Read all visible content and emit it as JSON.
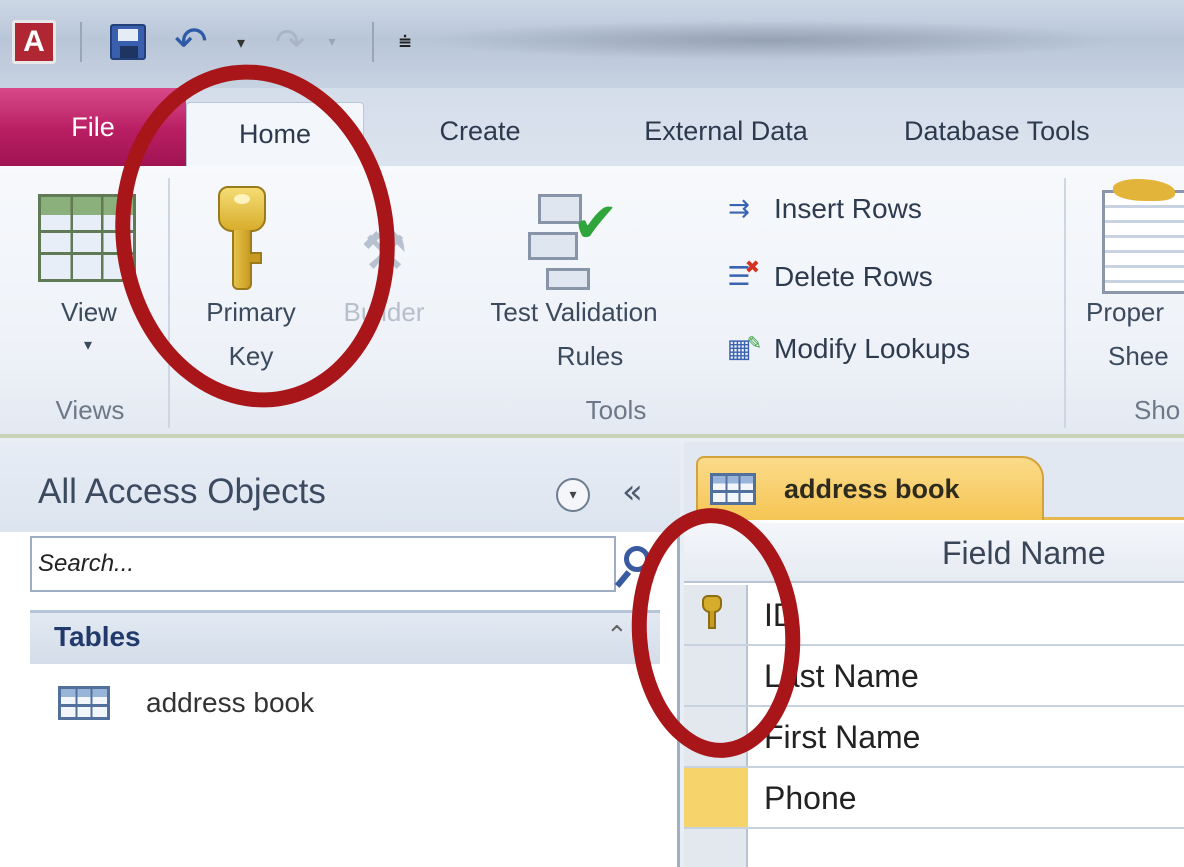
{
  "quick_access_toolbar": {
    "app_icon_letter": "A",
    "icons": [
      "save-icon",
      "undo-icon",
      "redo-icon",
      "customize-icon"
    ]
  },
  "ribbon_tabs": {
    "file": "File",
    "home": "Home",
    "create": "Create",
    "external_data": "External Data",
    "database_tools": "Database Tools"
  },
  "ribbon": {
    "view_button_label": "View",
    "views_group_label": "Views",
    "primary_key_line1": "Primary",
    "primary_key_line2": "Key",
    "builder_label": "Builder",
    "test_validation_line1": "Test Validation",
    "test_validation_line2": "Rules",
    "insert_rows": "Insert Rows",
    "delete_rows": "Delete Rows",
    "modify_lookups": "Modify Lookups",
    "tools_group_label": "Tools",
    "property_sheet_line1": "Proper",
    "property_sheet_line2": "Shee",
    "show_group_label": "Sho"
  },
  "nav_pane": {
    "title": "All Access Objects",
    "search_placeholder": "Search...",
    "group_label": "Tables",
    "items": [
      {
        "label": "address book"
      }
    ]
  },
  "document": {
    "tab_label": "address book",
    "column_header": "Field Name",
    "rows": [
      {
        "field": "ID",
        "primary_key": true
      },
      {
        "field": "Last Name",
        "primary_key": false
      },
      {
        "field": "First Name",
        "primary_key": false
      },
      {
        "field": "Phone",
        "primary_key": false,
        "current": true
      }
    ]
  },
  "colors": {
    "file_tab": "#b81e62",
    "annotation": "#a8161a",
    "active_tab": "#f5c554"
  }
}
